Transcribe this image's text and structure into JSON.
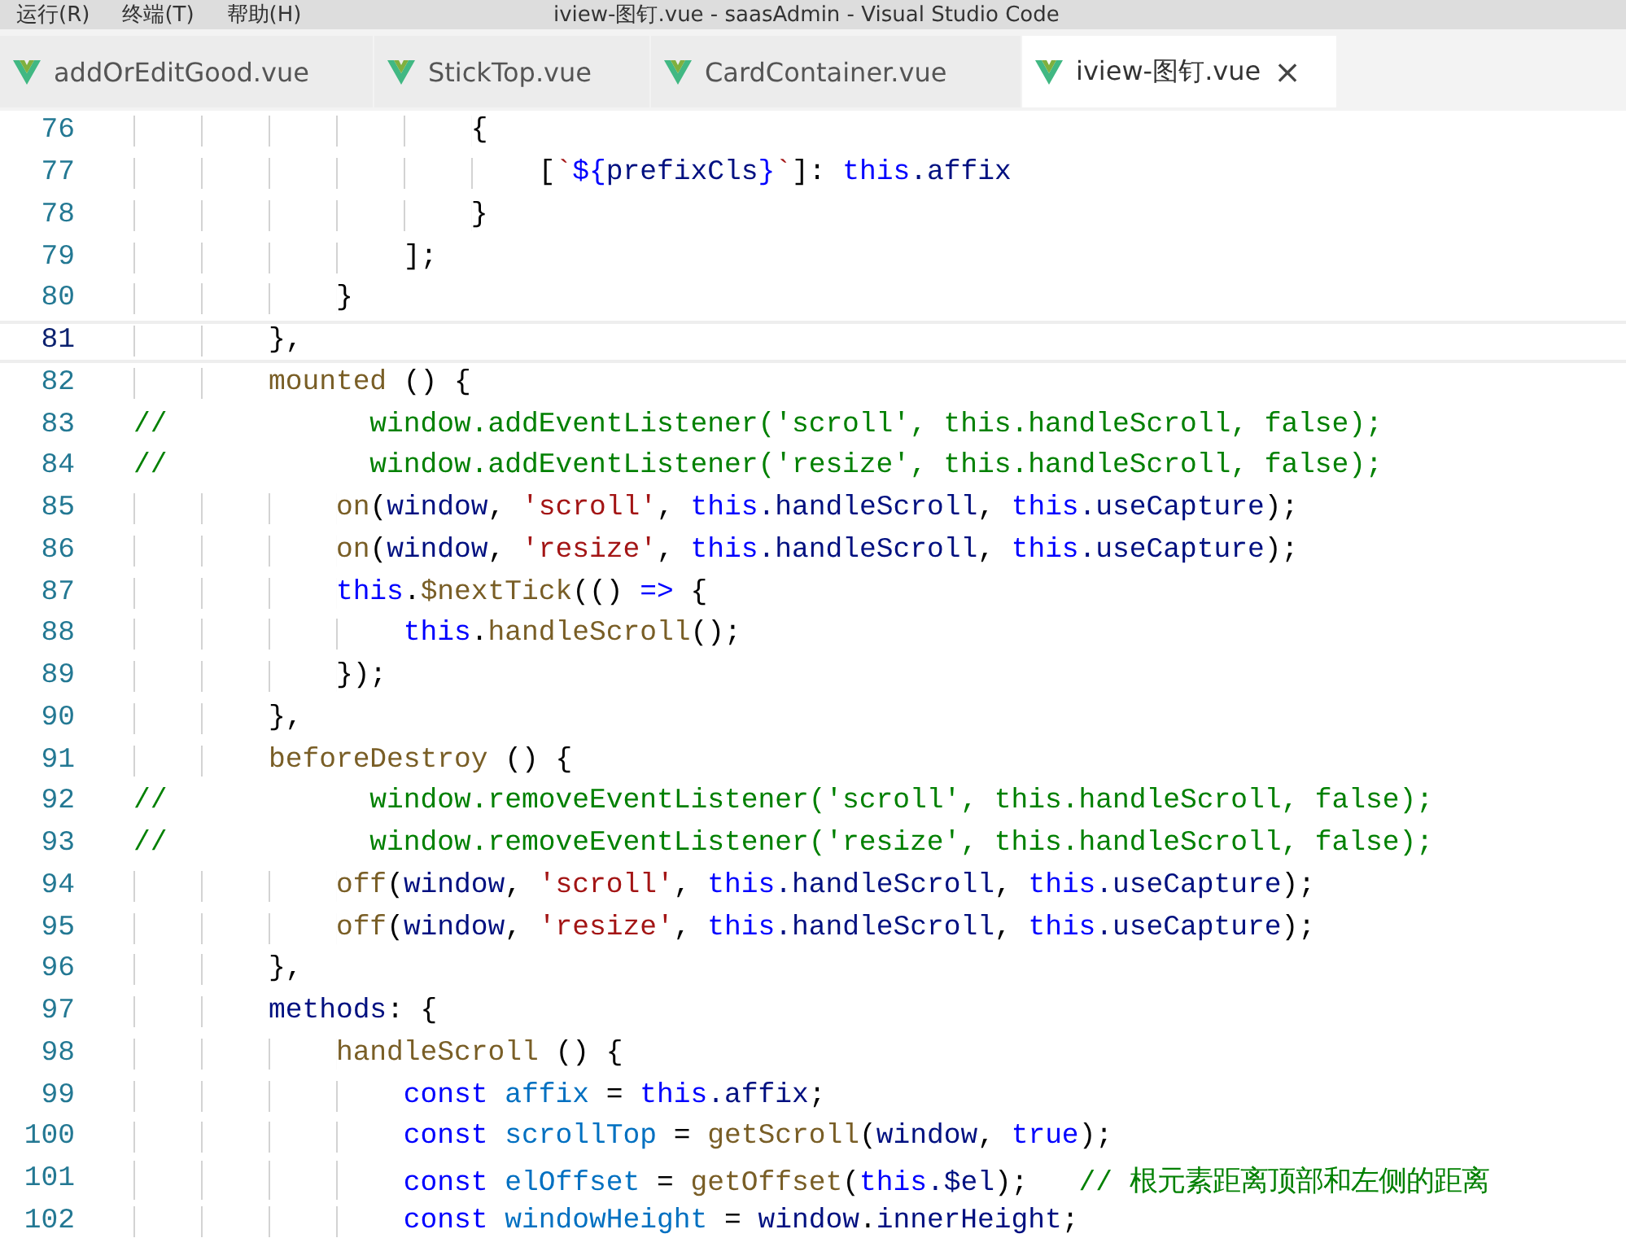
{
  "window": {
    "title": "iview-图钉.vue - saasAdmin - Visual Studio Code"
  },
  "menu": [
    "运行(R)",
    "终端(T)",
    "帮助(H)"
  ],
  "tabs": [
    {
      "label": "addOrEditGood.vue",
      "selected": false
    },
    {
      "label": "StickTop.vue",
      "selected": false
    },
    {
      "label": "CardContainer.vue",
      "selected": false
    },
    {
      "label": "iview-图钉.vue",
      "selected": true,
      "close": "×"
    }
  ],
  "editor": {
    "lines": [
      {
        "number": "76",
        "current": false,
        "tokens": [
          {
            "text": "                    {",
            "kind": "plain"
          }
        ]
      },
      {
        "number": "77",
        "current": false,
        "tokens": [
          {
            "text": "                        [",
            "kind": "plain"
          },
          {
            "text": "`",
            "kind": "string"
          },
          {
            "text": "${",
            "kind": "keyword"
          },
          {
            "text": "prefixCls",
            "kind": "var"
          },
          {
            "text": "}",
            "kind": "keyword"
          },
          {
            "text": "`",
            "kind": "string"
          },
          {
            "text": "]:",
            "kind": "plain"
          },
          {
            "text": " this",
            "kind": "keyword"
          },
          {
            "text": ".affix",
            "kind": "var"
          }
        ]
      },
      {
        "number": "78",
        "current": false,
        "tokens": [
          {
            "text": "                    }",
            "kind": "plain"
          }
        ]
      },
      {
        "number": "79",
        "current": false,
        "tokens": [
          {
            "text": "                ];",
            "kind": "plain"
          }
        ]
      },
      {
        "number": "80",
        "current": false,
        "tokens": [
          {
            "text": "            }",
            "kind": "plain"
          }
        ]
      },
      {
        "number": "81",
        "current": true,
        "tokens": [
          {
            "text": "        },",
            "kind": "plain"
          }
        ]
      },
      {
        "number": "82",
        "current": false,
        "tokens": [
          {
            "text": "        mounted",
            "kind": "fn"
          },
          {
            "text": " () {",
            "kind": "plain"
          }
        ]
      },
      {
        "number": "83",
        "current": false,
        "tokens": [
          {
            "text": "//            window.addEventListener('scroll', this.handleScroll, false);",
            "kind": "comment"
          }
        ]
      },
      {
        "number": "84",
        "current": false,
        "tokens": [
          {
            "text": "//            window.addEventListener('resize', this.handleScroll, false);",
            "kind": "comment"
          }
        ]
      },
      {
        "number": "85",
        "current": false,
        "tokens": [
          {
            "text": "            on",
            "kind": "fn"
          },
          {
            "text": "(",
            "kind": "plain"
          },
          {
            "text": "window",
            "kind": "var"
          },
          {
            "text": ",",
            "kind": "plain"
          },
          {
            "text": " 'scroll'",
            "kind": "string"
          },
          {
            "text": ",",
            "kind": "plain"
          },
          {
            "text": " this",
            "kind": "keyword"
          },
          {
            "text": ".handleScroll",
            "kind": "var"
          },
          {
            "text": ",",
            "kind": "plain"
          },
          {
            "text": " this",
            "kind": "keyword"
          },
          {
            "text": ".useCapture",
            "kind": "var"
          },
          {
            "text": ");",
            "kind": "plain"
          }
        ]
      },
      {
        "number": "86",
        "current": false,
        "tokens": [
          {
            "text": "            on",
            "kind": "fn"
          },
          {
            "text": "(",
            "kind": "plain"
          },
          {
            "text": "window",
            "kind": "var"
          },
          {
            "text": ",",
            "kind": "plain"
          },
          {
            "text": " 'resize'",
            "kind": "string"
          },
          {
            "text": ",",
            "kind": "plain"
          },
          {
            "text": " this",
            "kind": "keyword"
          },
          {
            "text": ".handleScroll",
            "kind": "var"
          },
          {
            "text": ",",
            "kind": "plain"
          },
          {
            "text": " this",
            "kind": "keyword"
          },
          {
            "text": ".useCapture",
            "kind": "var"
          },
          {
            "text": ");",
            "kind": "plain"
          }
        ]
      },
      {
        "number": "87",
        "current": false,
        "tokens": [
          {
            "text": "            this",
            "kind": "keyword"
          },
          {
            "text": ".",
            "kind": "plain"
          },
          {
            "text": "$nextTick",
            "kind": "fn"
          },
          {
            "text": "(()",
            "kind": "plain"
          },
          {
            "text": " =>",
            "kind": "keyword"
          },
          {
            "text": " {",
            "kind": "plain"
          }
        ]
      },
      {
        "number": "88",
        "current": false,
        "tokens": [
          {
            "text": "                this",
            "kind": "keyword"
          },
          {
            "text": ".",
            "kind": "plain"
          },
          {
            "text": "handleScroll",
            "kind": "fn"
          },
          {
            "text": "();",
            "kind": "plain"
          }
        ]
      },
      {
        "number": "89",
        "current": false,
        "tokens": [
          {
            "text": "            });",
            "kind": "plain"
          }
        ]
      },
      {
        "number": "90",
        "current": false,
        "tokens": [
          {
            "text": "        },",
            "kind": "plain"
          }
        ]
      },
      {
        "number": "91",
        "current": false,
        "tokens": [
          {
            "text": "        beforeDestroy",
            "kind": "fn"
          },
          {
            "text": " () {",
            "kind": "plain"
          }
        ]
      },
      {
        "number": "92",
        "current": false,
        "tokens": [
          {
            "text": "//            window.removeEventListener('scroll', this.handleScroll, false);",
            "kind": "comment"
          }
        ]
      },
      {
        "number": "93",
        "current": false,
        "tokens": [
          {
            "text": "//            window.removeEventListener('resize', this.handleScroll, false);",
            "kind": "comment"
          }
        ]
      },
      {
        "number": "94",
        "current": false,
        "tokens": [
          {
            "text": "            off",
            "kind": "fn"
          },
          {
            "text": "(",
            "kind": "plain"
          },
          {
            "text": "window",
            "kind": "var"
          },
          {
            "text": ",",
            "kind": "plain"
          },
          {
            "text": " 'scroll'",
            "kind": "string"
          },
          {
            "text": ",",
            "kind": "plain"
          },
          {
            "text": " this",
            "kind": "keyword"
          },
          {
            "text": ".handleScroll",
            "kind": "var"
          },
          {
            "text": ",",
            "kind": "plain"
          },
          {
            "text": " this",
            "kind": "keyword"
          },
          {
            "text": ".useCapture",
            "kind": "var"
          },
          {
            "text": ");",
            "kind": "plain"
          }
        ]
      },
      {
        "number": "95",
        "current": false,
        "tokens": [
          {
            "text": "            off",
            "kind": "fn"
          },
          {
            "text": "(",
            "kind": "plain"
          },
          {
            "text": "window",
            "kind": "var"
          },
          {
            "text": ",",
            "kind": "plain"
          },
          {
            "text": " 'resize'",
            "kind": "string"
          },
          {
            "text": ",",
            "kind": "plain"
          },
          {
            "text": " this",
            "kind": "keyword"
          },
          {
            "text": ".handleScroll",
            "kind": "var"
          },
          {
            "text": ",",
            "kind": "plain"
          },
          {
            "text": " this",
            "kind": "keyword"
          },
          {
            "text": ".useCapture",
            "kind": "var"
          },
          {
            "text": ");",
            "kind": "plain"
          }
        ]
      },
      {
        "number": "96",
        "current": false,
        "tokens": [
          {
            "text": "        },",
            "kind": "plain"
          }
        ]
      },
      {
        "number": "97",
        "current": false,
        "tokens": [
          {
            "text": "        methods",
            "kind": "var"
          },
          {
            "text": ": {",
            "kind": "plain"
          }
        ]
      },
      {
        "number": "98",
        "current": false,
        "tokens": [
          {
            "text": "            handleScroll",
            "kind": "fn"
          },
          {
            "text": " () {",
            "kind": "plain"
          }
        ]
      },
      {
        "number": "99",
        "current": false,
        "tokens": [
          {
            "text": "                const",
            "kind": "keyword"
          },
          {
            "text": " affix",
            "kind": "const"
          },
          {
            "text": " =",
            "kind": "plain"
          },
          {
            "text": " this",
            "kind": "keyword"
          },
          {
            "text": ".affix",
            "kind": "var"
          },
          {
            "text": ";",
            "kind": "plain"
          }
        ]
      },
      {
        "number": "100",
        "current": false,
        "tokens": [
          {
            "text": "                const",
            "kind": "keyword"
          },
          {
            "text": " scrollTop",
            "kind": "const"
          },
          {
            "text": " =",
            "kind": "plain"
          },
          {
            "text": " getScroll",
            "kind": "fn"
          },
          {
            "text": "(",
            "kind": "plain"
          },
          {
            "text": "window",
            "kind": "var"
          },
          {
            "text": ",",
            "kind": "plain"
          },
          {
            "text": " true",
            "kind": "keyword"
          },
          {
            "text": ");",
            "kind": "plain"
          }
        ]
      },
      {
        "number": "101",
        "current": false,
        "tokens": [
          {
            "text": "                const",
            "kind": "keyword"
          },
          {
            "text": " elOffset",
            "kind": "const"
          },
          {
            "text": " =",
            "kind": "plain"
          },
          {
            "text": " getOffset",
            "kind": "fn"
          },
          {
            "text": "(",
            "kind": "plain"
          },
          {
            "text": "this",
            "kind": "keyword"
          },
          {
            "text": ".$el",
            "kind": "var"
          },
          {
            "text": ");",
            "kind": "plain"
          },
          {
            "text": "   // 根元素距离顶部和左侧的距离",
            "kind": "comment"
          }
        ]
      },
      {
        "number": "102",
        "current": false,
        "tokens": [
          {
            "text": "                const",
            "kind": "keyword"
          },
          {
            "text": " windowHeight",
            "kind": "const"
          },
          {
            "text": " =",
            "kind": "plain"
          },
          {
            "text": " window",
            "kind": "var"
          },
          {
            "text": ".",
            "kind": "plain"
          },
          {
            "text": "innerHeight",
            "kind": "var"
          },
          {
            "text": ";",
            "kind": "plain"
          }
        ]
      }
    ]
  }
}
